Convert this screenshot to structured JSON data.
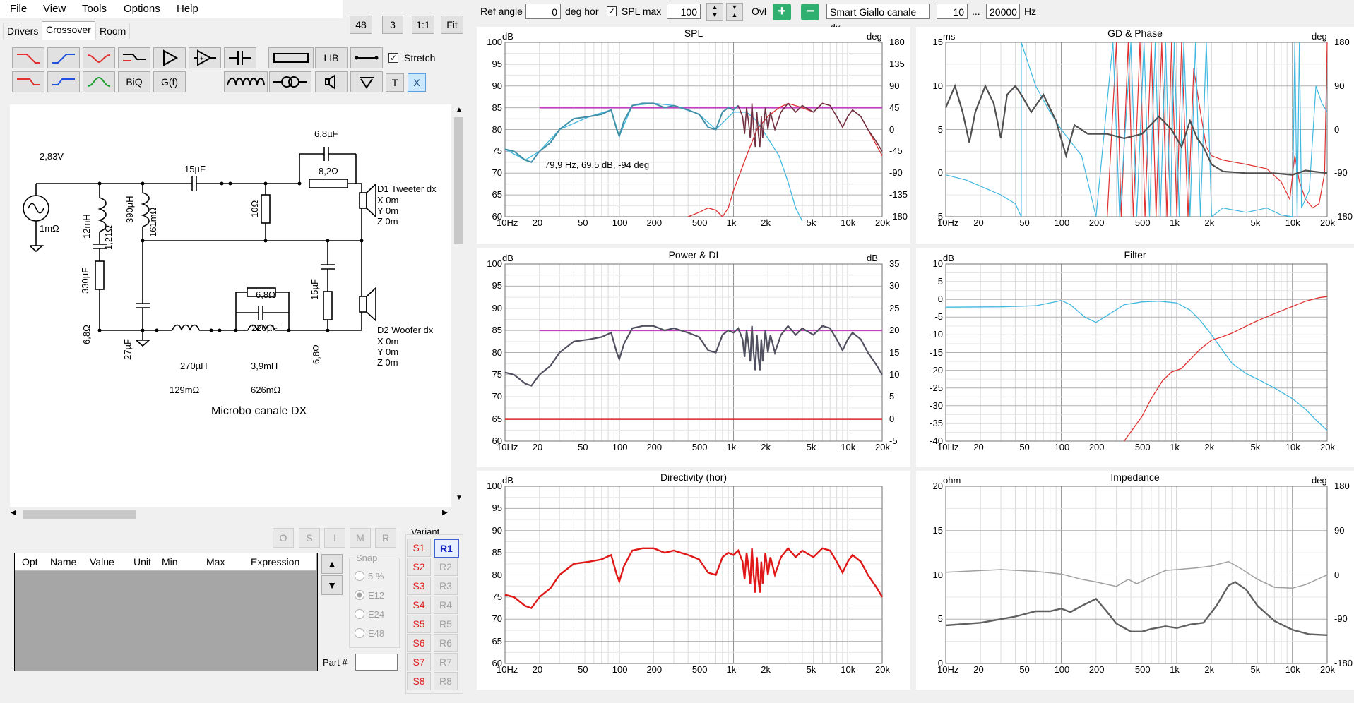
{
  "menu": [
    "File",
    "View",
    "Tools",
    "Options",
    "Help"
  ],
  "top_buttons": [
    "48",
    "3",
    "1:1",
    "Fit"
  ],
  "tabs": [
    "Drivers",
    "Crossover",
    "Room"
  ],
  "toolbar": {
    "lib_label": "LIB",
    "biq_label": "BiQ",
    "gf_label": "G(f)",
    "t_label": "T",
    "x_label": "X",
    "stretch_label": "Stretch"
  },
  "schematic": {
    "title": "Microbo canale DX",
    "source_voltage": "2,83V",
    "source_res": "1mΩ",
    "c_15uf_top": "15µF",
    "c_68uf": "6,8µF",
    "r_82": "8,2Ω",
    "r_10": "10Ω",
    "l_12mh": "12mH",
    "l_12mh_res": "1,21Ω",
    "l_390uh": "390µH",
    "l_390uh_res": "161mΩ",
    "c_330uf": "330µF",
    "r_68_left": "6,8Ω",
    "c_27uf": "27µF",
    "l_270uh": "270µH",
    "l_270uh_res": "129mΩ",
    "r_68_top": "6,8Ω",
    "c_220uf": "220µF",
    "l_39mh": "3,9mH",
    "l_39mh_res": "626mΩ",
    "c_15uf_right": "15µF",
    "r_68_right": "6,8Ω",
    "d1": [
      "D1 Tweeter dx",
      "X 0m",
      "Y 0m",
      "Z 0m"
    ],
    "d2": [
      "D2 Woofer dx",
      "X 0m",
      "Y 0m",
      "Z 0m"
    ]
  },
  "optim_buttons": [
    "O",
    "S",
    "I",
    "M",
    "R"
  ],
  "grid_headers": [
    "Opt",
    "Name",
    "Value",
    "Unit",
    "Min",
    "Max",
    "Expression"
  ],
  "snap": {
    "label": "Snap",
    "options": [
      "5 %",
      "E12",
      "E24",
      "E48"
    ],
    "selected": "E12"
  },
  "part_label": "Part #",
  "variant": {
    "label": "Variant",
    "s": [
      "S1",
      "S2",
      "S3",
      "S4",
      "S5",
      "S6",
      "S7",
      "S8"
    ],
    "r": [
      "R1",
      "R2",
      "R3",
      "R4",
      "R5",
      "R6",
      "R7",
      "R8"
    ],
    "selected": "R1"
  },
  "topbar": {
    "ref_angle_label": "Ref angle",
    "ref_angle_value": "0",
    "deg_hor": "deg hor",
    "spl_max_label": "SPL max",
    "spl_max_value": "100",
    "ovl_label": "Ovl",
    "driver_select": "Smart Giallo canale dx",
    "f_min": "10",
    "range_sep": "...",
    "f_max": "20000",
    "hz": "Hz"
  },
  "colors": {
    "red": "#e03030",
    "cyan": "#40b8e0",
    "magenta": "#c040c0",
    "grey": "#505060",
    "teal": "#4090a8"
  },
  "x_ticks": [
    "10Hz",
    "20",
    "50",
    "100",
    "200",
    "500",
    "1k",
    "2k",
    "5k",
    "10k",
    "20k"
  ],
  "charts": {
    "spl": {
      "title": "SPL",
      "left_unit": "dB",
      "right_unit": "deg",
      "left_ticks": [
        "100",
        "95",
        "90",
        "85",
        "80",
        "75",
        "70",
        "65",
        "60"
      ],
      "right_ticks": [
        "180",
        "135",
        "90",
        "45",
        "0",
        "-45",
        "-90",
        "-135",
        "-180"
      ],
      "cursor_readout": "79,9 Hz, 69,5 dB, -94 deg"
    },
    "gd": {
      "title": "GD & Phase",
      "left_unit": "ms",
      "right_unit": "deg",
      "left_ticks": [
        "15",
        "10",
        "5",
        "0",
        "-5"
      ],
      "right_ticks": [
        "180",
        "90",
        "0",
        "-90",
        "-180"
      ]
    },
    "power": {
      "title": "Power & DI",
      "left_unit": "dB",
      "right_unit": "dB",
      "left_ticks": [
        "100",
        "95",
        "90",
        "85",
        "80",
        "75",
        "70",
        "65",
        "60"
      ],
      "right_ticks": [
        "35",
        "30",
        "25",
        "20",
        "15",
        "10",
        "5",
        "0",
        "-5"
      ]
    },
    "filter": {
      "title": "Filter",
      "left_unit": "dB",
      "left_ticks": [
        "10",
        "5",
        "0",
        "-5",
        "-10",
        "-15",
        "-20",
        "-25",
        "-30",
        "-35",
        "-40"
      ]
    },
    "directivity": {
      "title": "Directivity (hor)",
      "left_unit": "dB",
      "left_ticks": [
        "100",
        "95",
        "90",
        "85",
        "80",
        "75",
        "70",
        "65",
        "60"
      ]
    },
    "impedance": {
      "title": "Impedance",
      "left_unit": "ohm",
      "right_unit": "deg",
      "left_ticks": [
        "20",
        "15",
        "10",
        "5",
        "0"
      ],
      "right_ticks": [
        "180",
        "90",
        "0",
        "-90",
        "-180"
      ]
    }
  }
}
